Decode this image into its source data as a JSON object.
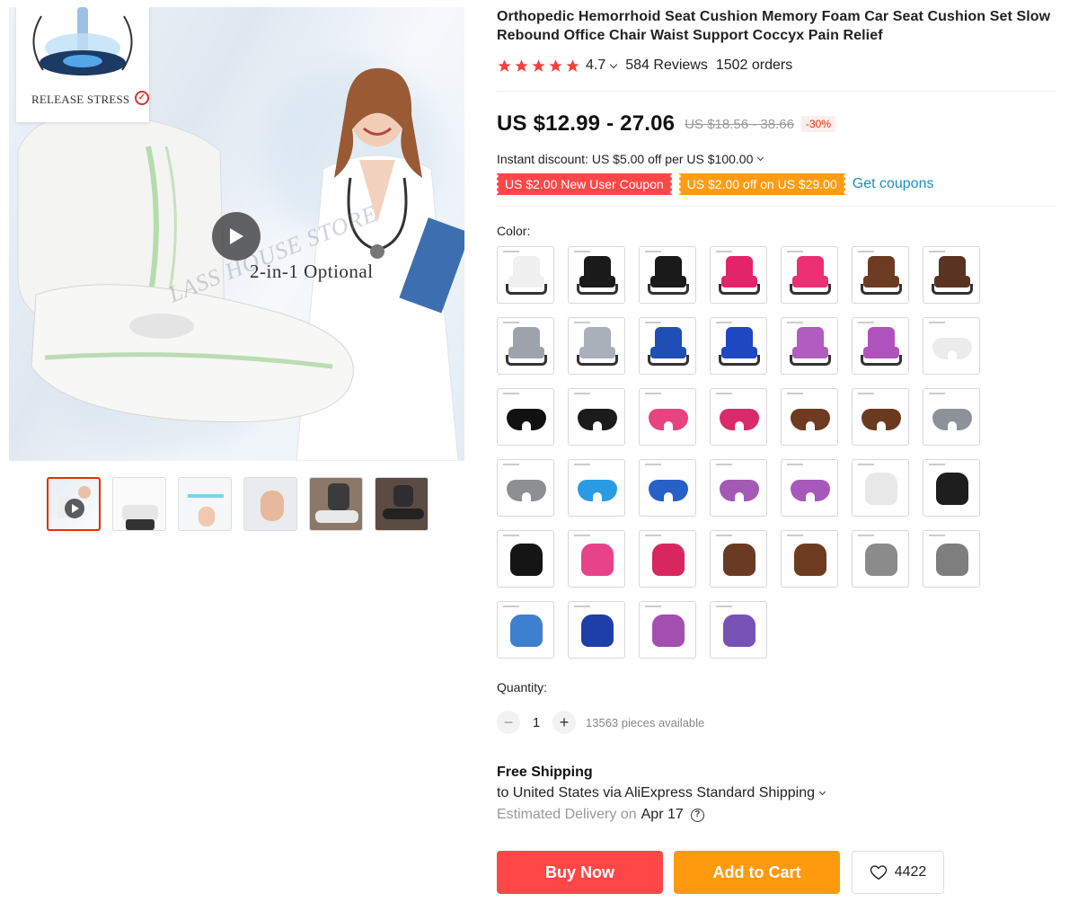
{
  "gallery": {
    "badge_text": "RELEASE STRESS",
    "overlay_text": "2-in-1 Optional",
    "watermark_text": "LASS HOUSE STORE",
    "thumbnails": [
      "video-thumb",
      "cushion-comfort",
      "memory-foam",
      "hand-press",
      "car-seat",
      "driver-seat"
    ]
  },
  "product": {
    "title": "Orthopedic Hemorrhoid Seat Cushion Memory Foam Car Seat Cushion Set Slow Rebound Office Chair Waist Support Coccyx Pain Relief",
    "rating": "4.7",
    "reviews": "584 Reviews",
    "orders": "1502 orders",
    "price": "US $12.99 - 27.06",
    "old_price": "US $18.56 - 38.66",
    "discount": "-30%",
    "instant_discount": "Instant discount: US $5.00 off per US $100.00",
    "coupons": [
      "US $2.00 New User Coupon",
      "US $2.00 off on US $29.00"
    ],
    "get_coupons": "Get coupons",
    "color_label": "Color:",
    "quantity_label": "Quantity:",
    "quantity": "1",
    "available": "13563 pieces available",
    "shipping_title": "Free Shipping",
    "shipping_to": "to United States via AliExpress Standard Shipping",
    "est_label": "Estimated Delivery on",
    "est_date": "Apr 17",
    "buy_now": "Buy Now",
    "add_to_cart": "Add to Cart",
    "wishlist_count": "4422",
    "colors": {
      "primary_red": "#ff4747",
      "cart_orange": "#ff9a0f",
      "link_blue": "#1a8fc5",
      "star": "#f5403b"
    }
  },
  "swatches": [
    {
      "kind": "chair",
      "color": "#f0f0f0"
    },
    {
      "kind": "chair",
      "color": "#1a1a1a"
    },
    {
      "kind": "chair",
      "color": "#1a1a1a"
    },
    {
      "kind": "chair",
      "color": "#e3246b"
    },
    {
      "kind": "chair",
      "color": "#ea2f73"
    },
    {
      "kind": "chair",
      "color": "#6b3c22"
    },
    {
      "kind": "chair",
      "color": "#5a3322"
    },
    {
      "kind": "chair",
      "color": "#9ea3ab"
    },
    {
      "kind": "chair",
      "color": "#a9b0ba"
    },
    {
      "kind": "chair",
      "color": "#1f4fb5"
    },
    {
      "kind": "chair",
      "color": "#1f47c2"
    },
    {
      "kind": "chair",
      "color": "#b05cc0"
    },
    {
      "kind": "chair",
      "color": "#b052be"
    },
    {
      "kind": "cushion",
      "color": "#ececec"
    },
    {
      "kind": "cushion",
      "color": "#111111"
    },
    {
      "kind": "cushion",
      "color": "#1b1b1b"
    },
    {
      "kind": "cushion",
      "color": "#e7437e"
    },
    {
      "kind": "cushion",
      "color": "#d92b67"
    },
    {
      "kind": "cushion",
      "color": "#6e3b1f"
    },
    {
      "kind": "cushion",
      "color": "#6b3a1e"
    },
    {
      "kind": "cushion",
      "color": "#8d929a"
    },
    {
      "kind": "cushion",
      "color": "#8d8f92"
    },
    {
      "kind": "cushion",
      "color": "#2a9be2"
    },
    {
      "kind": "cushion",
      "color": "#2660c9"
    },
    {
      "kind": "cushion",
      "color": "#a35ab5"
    },
    {
      "kind": "cushion",
      "color": "#a858ba"
    },
    {
      "kind": "lumbar",
      "color": "#e8e8e8"
    },
    {
      "kind": "lumbar",
      "color": "#1e1e1e"
    },
    {
      "kind": "lumbar",
      "color": "#151515"
    },
    {
      "kind": "lumbar",
      "color": "#e8428b"
    },
    {
      "kind": "lumbar",
      "color": "#d8275e"
    },
    {
      "kind": "lumbar",
      "color": "#6a3b23"
    },
    {
      "kind": "lumbar",
      "color": "#6d3c20"
    },
    {
      "kind": "lumbar",
      "color": "#8b8b8b"
    },
    {
      "kind": "lumbar",
      "color": "#7e7e7e"
    },
    {
      "kind": "lumbar",
      "color": "#3f7fcf"
    },
    {
      "kind": "lumbar",
      "color": "#1d3fa8"
    },
    {
      "kind": "lumbar",
      "color": "#a34fb0"
    },
    {
      "kind": "lumbar",
      "color": "#7752b5"
    }
  ]
}
